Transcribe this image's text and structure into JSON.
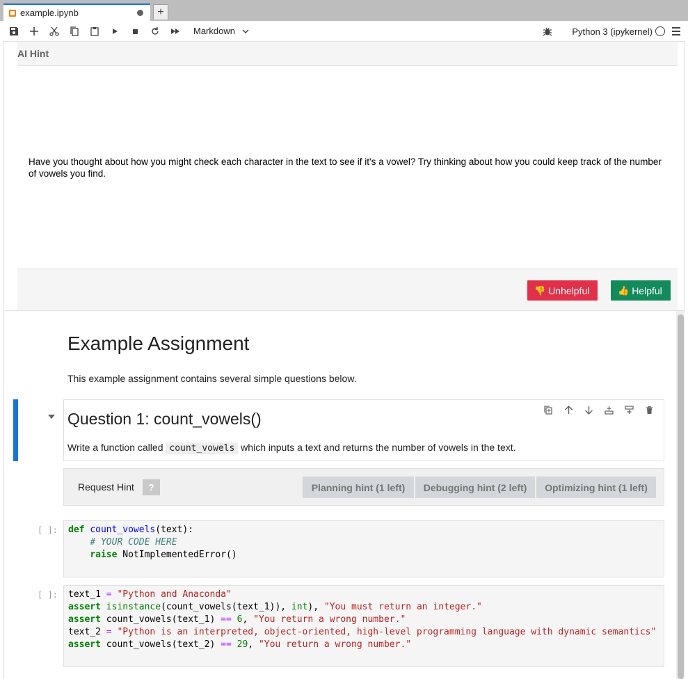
{
  "tab": {
    "title": "example.ipynb"
  },
  "toolbar": {
    "cell_type": "Markdown",
    "kernel_name": "Python 3 (ipykernel)"
  },
  "ai_hint": {
    "header": "AI Hint",
    "body": "Have you thought about how you might check each character in the text to see if it's a vowel? Try thinking about how you could keep track of the number of vowels you find.",
    "unhelpful_label": "Unhelpful",
    "helpful_label": "Helpful"
  },
  "notebook": {
    "title": "Example Assignment",
    "intro": "This example assignment contains several simple questions below.",
    "question": {
      "title": "Question 1: count_vowels()",
      "text_before": "Write a function called ",
      "code": "count_vowels",
      "text_after": " which inputs a text and returns the number of vowels in the text."
    },
    "hint_bar": {
      "label": "Request Hint",
      "help": "?",
      "planning": "Planning hint (1 left)",
      "debugging": "Debugging hint (2 left)",
      "optimizing": "Optimizing hint (1 left)"
    },
    "prompt": "[ ]:",
    "code1": {
      "l1_kw": "def",
      "l1_fn": "count_vowels",
      "l1_rest": "(text):",
      "l2_comment": "# YOUR CODE HERE",
      "l3_kw": "raise",
      "l3_rest": " NotImplementedError()"
    },
    "code2": {
      "l1_var": "text_1 ",
      "l1_op": "=",
      "l1_str": "\"Python and Anaconda\"",
      "l2_kw": "assert",
      "l2_bi": "isinstance",
      "l2_mid": "(count_vowels(text_1)), ",
      "l2_bi2": "int",
      "l2_mid2": "), ",
      "l2_str": "\"You must return an integer.\"",
      "l3_kw": "assert",
      "l3_mid": " count_vowels(text_1) ",
      "l3_op": "==",
      "l3_num": "6",
      "l3_str": "\"You return a wrong number.\"",
      "l4_var": "text_2 ",
      "l4_op": "=",
      "l4_str": "\"Python is an interpreted, object-oriented, high-level programming language with dynamic semantics\"",
      "l5_kw": "assert",
      "l5_mid": " count_vowels(text_2) ",
      "l5_op": "==",
      "l5_num": "29",
      "l5_str": "\"You return a wrong number.\""
    }
  },
  "colors": {
    "unhelpful": "#e0304a",
    "helpful": "#128a5c",
    "active_cell": "#1976d2"
  }
}
